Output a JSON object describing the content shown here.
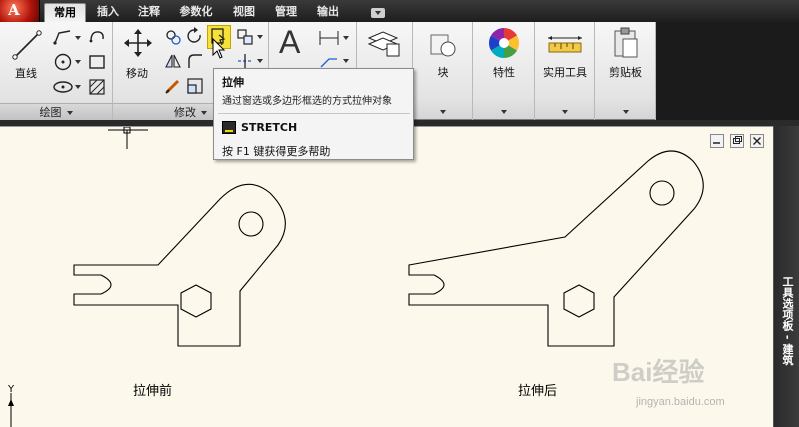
{
  "tabs": [
    {
      "label": "常用",
      "active": true
    },
    {
      "label": "插入",
      "active": false
    },
    {
      "label": "注释",
      "active": false
    },
    {
      "label": "参数化",
      "active": false
    },
    {
      "label": "视图",
      "active": false
    },
    {
      "label": "管理",
      "active": false
    },
    {
      "label": "输出",
      "active": false
    }
  ],
  "ribbon": {
    "draw_panel": {
      "title": "绘图",
      "line_label": "直线"
    },
    "modify_panel": {
      "title": "修改",
      "move_label": "移动"
    },
    "annotate_panel": {
      "text_icon": "A"
    },
    "block_panel": {
      "label": "块"
    },
    "properties_panel": {
      "label": "特性"
    },
    "utilities_panel": {
      "label": "实用工具"
    },
    "clipboard_panel": {
      "label": "剪贴板"
    }
  },
  "tooltip": {
    "title": "拉伸",
    "description": "通过窗选或多边形框选的方式拉伸对象",
    "command": "STRETCH",
    "help": "按 F1 键获得更多帮助"
  },
  "canvas": {
    "caption_before": "拉伸前",
    "caption_after": "拉伸后",
    "ucs_label": "Y"
  },
  "tool_palette": {
    "label": "工具选项板 - 建筑"
  },
  "watermark": {
    "brand": "Bai经验",
    "url": "jingyan.baidu.com"
  },
  "colors": {
    "canvas_bg": "#fcf9ec",
    "ribbon_bg": "#ececec",
    "app_red": "#c4170c",
    "highlight": "#f5e13a"
  }
}
